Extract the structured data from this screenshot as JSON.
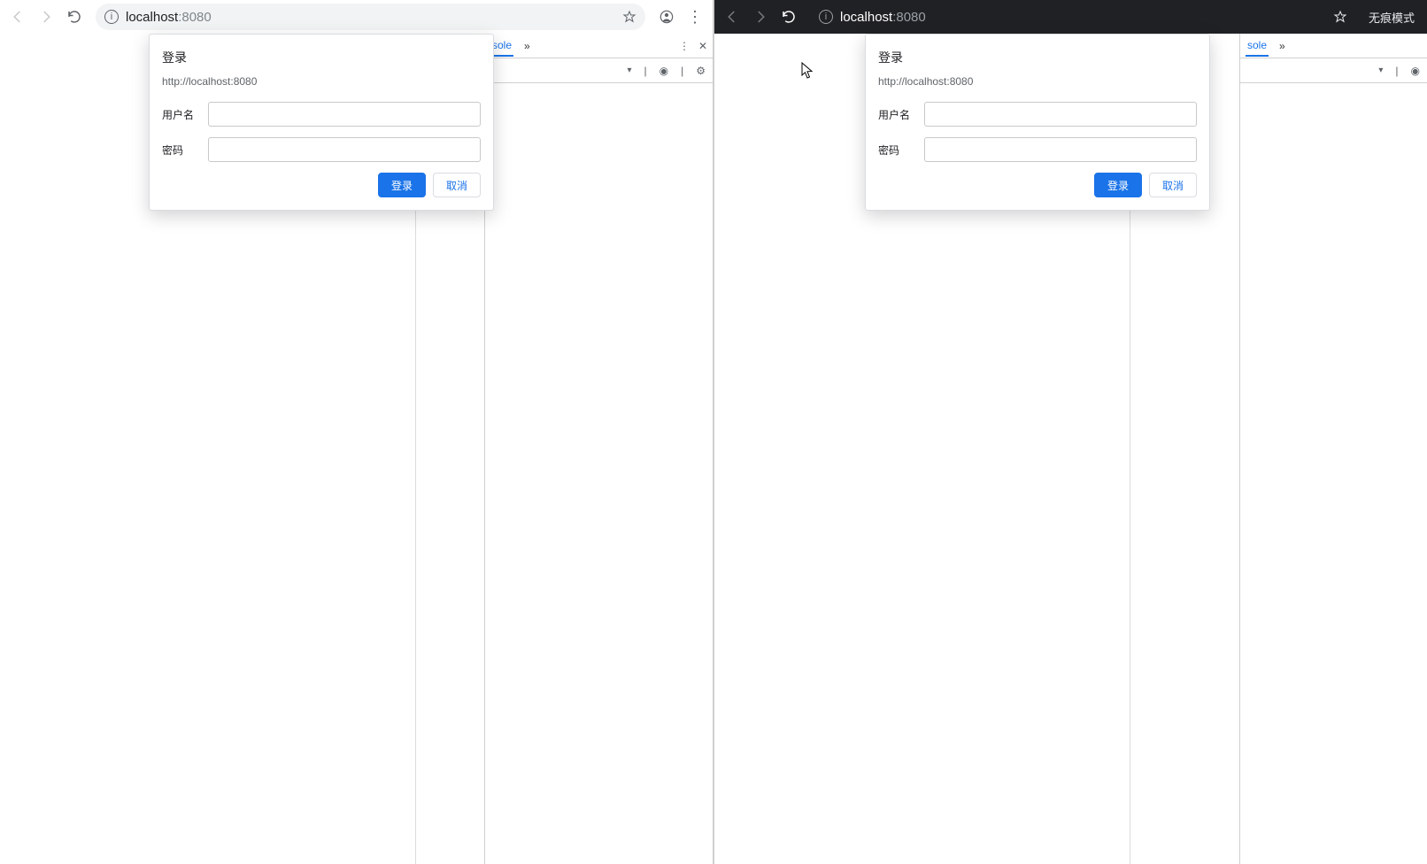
{
  "left": {
    "toolbar": {
      "url_main": "localhost",
      "url_suffix": ":8080"
    },
    "devtools": {
      "tab_label": "sole",
      "expand_glyph": "»",
      "eye_glyph": "◉",
      "gear_glyph": "⚙",
      "tri_glyph": "▾",
      "kebab": "⋮",
      "close": "✕"
    },
    "dialog": {
      "title": "登录",
      "url": "http://localhost:8080",
      "username_label": "用户名",
      "password_label": "密码",
      "submit": "登录",
      "cancel": "取消"
    }
  },
  "right": {
    "toolbar": {
      "url_main": "localhost",
      "url_suffix": ":8080",
      "incognito_label": "无痕模式"
    },
    "devtools": {
      "tab_label": "sole",
      "expand_glyph": "»",
      "tri_glyph": "▾",
      "eye_glyph": "◉"
    },
    "dialog": {
      "title": "登录",
      "url": "http://localhost:8080",
      "username_label": "用户名",
      "password_label": "密码",
      "submit": "登录",
      "cancel": "取消"
    }
  }
}
